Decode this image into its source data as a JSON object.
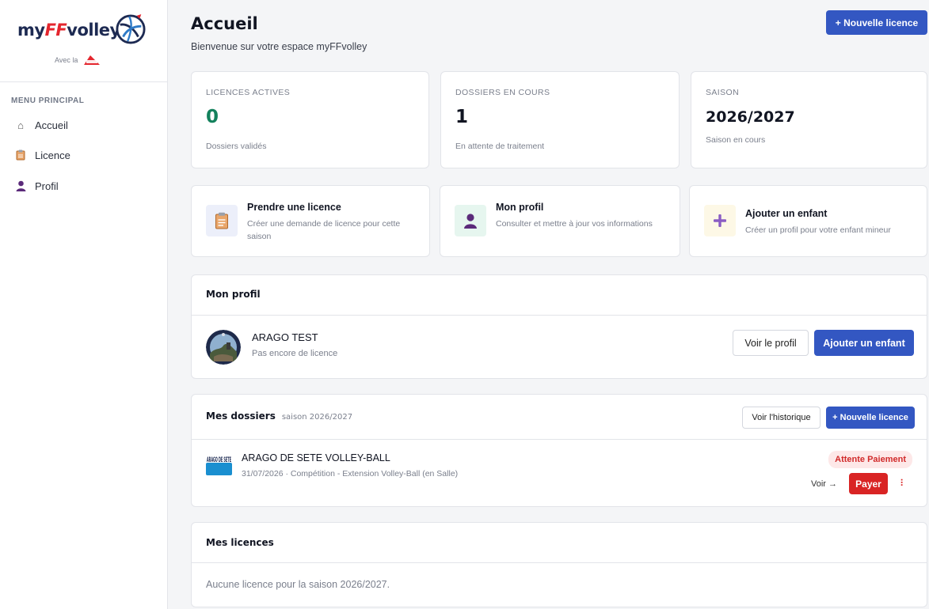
{
  "brand": {
    "logo_prefix": "my",
    "logo_ff": "FF",
    "logo_suffix": "volley",
    "partner_text": "Avec la"
  },
  "menu": {
    "title": "MENU PRINCIPAL",
    "items": [
      {
        "label": "Accueil",
        "icon": "home-icon"
      },
      {
        "label": "Licence",
        "icon": "clipboard-icon"
      },
      {
        "label": "Profil",
        "icon": "user-icon"
      }
    ]
  },
  "header": {
    "title": "Accueil",
    "subtitle": "Bienvenue sur votre espace myFFvolley",
    "new_license": "+ Nouvelle licence"
  },
  "stats": [
    {
      "label": "LICENCES ACTIVES",
      "value": "0",
      "hint": "Dossiers validés"
    },
    {
      "label": "DOSSIERS EN COURS",
      "value": "1",
      "hint": "En attente de traitement"
    },
    {
      "label": "SAISON",
      "value": "2026/2027",
      "hint": "Saison en cours"
    }
  ],
  "actions": [
    {
      "title": "Prendre une licence",
      "desc": "Créer une demande de licence pour cette saison",
      "icon": "clipboard-icon"
    },
    {
      "title": "Mon profil",
      "desc": "Consulter et mettre à jour vos informations",
      "icon": "user-icon"
    },
    {
      "title": "Ajouter un enfant",
      "desc": "Créer un profil pour votre enfant mineur",
      "icon": "plus-icon"
    }
  ],
  "profile": {
    "section_title": "Mon profil",
    "name": "ARAGO TEST",
    "status": "Pas encore de licence",
    "view_button": "Voir le profil",
    "add_child_button": "Ajouter un enfant"
  },
  "dossiers": {
    "section_title": "Mes dossiers",
    "season_label": "saison 2026/2027",
    "history_button": "Voir l'historique",
    "new_button": "+ Nouvelle licence",
    "item": {
      "club_logo_text": "ARAGO DE SETE",
      "club": "ARAGO DE SETE VOLLEY-BALL",
      "details": "31/07/2026 · Compétition - Extension Volley-Ball (en Salle)",
      "status": "Attente Paiement",
      "view_link": "Voir →",
      "pay_button": "Payer",
      "more_label": "⠇"
    }
  },
  "licences": {
    "section_title": "Mes licences",
    "empty_text": "Aucune licence pour la saison 2026/2027."
  },
  "colors": {
    "primary": "#3357c2",
    "success": "#13815c",
    "danger": "#d92424",
    "brand_red": "#e4262e",
    "brand_navy": "#1d2a52"
  }
}
